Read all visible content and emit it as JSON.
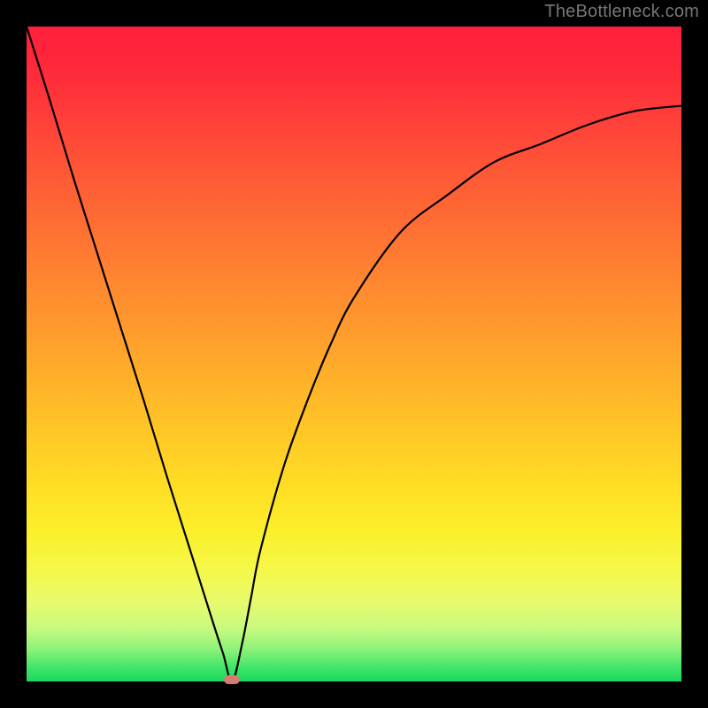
{
  "watermark": "TheBottleneck.com",
  "chart_data": {
    "type": "line",
    "title": "",
    "xlabel": "",
    "ylabel": "",
    "xlim": [
      0,
      1
    ],
    "ylim": [
      0,
      1
    ],
    "series": [
      {
        "name": "bottleneck-curve",
        "x": [
          0.0,
          0.036,
          0.071,
          0.107,
          0.143,
          0.179,
          0.214,
          0.25,
          0.286,
          0.3,
          0.314,
          0.329,
          0.343,
          0.357,
          0.393,
          0.429,
          0.464,
          0.5,
          0.571,
          0.643,
          0.714,
          0.786,
          0.857,
          0.929,
          1.0
        ],
        "y": [
          1.0,
          0.886,
          0.771,
          0.657,
          0.543,
          0.429,
          0.314,
          0.2,
          0.086,
          0.043,
          0.0,
          0.057,
          0.129,
          0.2,
          0.329,
          0.429,
          0.514,
          0.586,
          0.686,
          0.743,
          0.793,
          0.821,
          0.85,
          0.871,
          0.879
        ]
      }
    ],
    "min_marker": {
      "x": 0.314,
      "y": 0.0
    },
    "colors": {
      "gradient_top": "#ff1f3c",
      "gradient_bottom": "#17d95f",
      "curve": "#000000",
      "marker": "#d87a74",
      "frame": "#000000"
    }
  }
}
